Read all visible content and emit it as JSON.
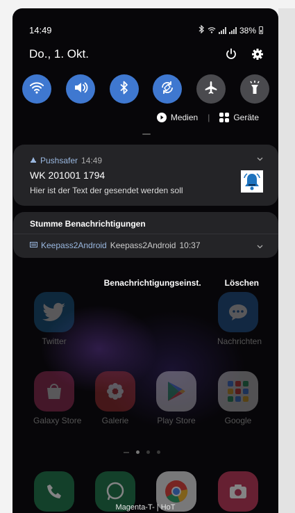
{
  "status": {
    "time": "14:49",
    "battery": "38%"
  },
  "date": "Do., 1. Okt.",
  "media": {
    "media_label": "Medien",
    "devices_label": "Geräte",
    "separator": "|"
  },
  "notification": {
    "app": "Pushsafer",
    "time": "14:49",
    "title": "WK 201001 1794",
    "text": "Hier ist der Text der gesendet werden soll"
  },
  "silent": {
    "header": "Stumme Benachrichtigungen",
    "app": "Keepass2Android",
    "title": "Keepass2Android",
    "time": "10:37"
  },
  "actions": {
    "settings": "Benachrichtigungseinst.",
    "clear": "Löschen"
  },
  "homescreen": {
    "apps": [
      "Twitter",
      "Nachrichten",
      "Galaxy Store",
      "Galerie",
      "Play Store",
      "Google"
    ],
    "carrier": "Magenta-T- | HoT"
  },
  "colors": {
    "toggle_on": "#3f78d0",
    "toggle_off": "#4a4a4e",
    "card": "#242427"
  },
  "toggles": [
    {
      "icon": "wifi-icon",
      "on": true
    },
    {
      "icon": "sound-icon",
      "on": true
    },
    {
      "icon": "bluetooth-icon",
      "on": true
    },
    {
      "icon": "auto-rotate-icon",
      "on": true
    },
    {
      "icon": "airplane-icon",
      "on": false
    },
    {
      "icon": "flashlight-icon",
      "on": false
    }
  ]
}
